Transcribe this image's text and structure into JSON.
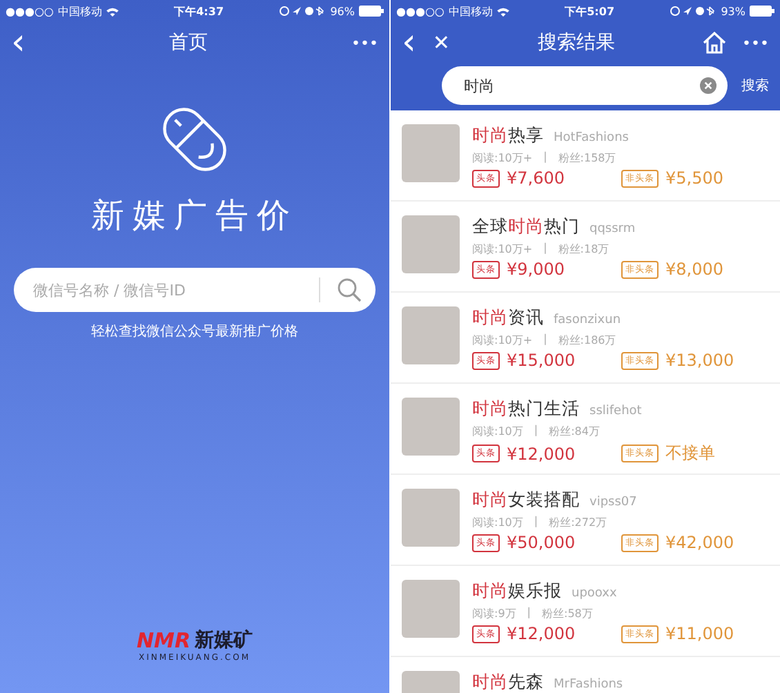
{
  "home_screen": {
    "status_bar": {
      "signal": "●●●○○",
      "carrier": "中国移动",
      "time": "下午4:37",
      "battery": "96%"
    },
    "nav": {
      "back": "‹",
      "title": "首页",
      "more": "•••"
    },
    "brand_title": "新媒广告价",
    "search": {
      "placeholder": "微信号名称 / 微信号ID"
    },
    "hint": "轻松查找微信公众号最新推广价格",
    "footer_logo": {
      "mark": "NMR",
      "name": "新媒矿",
      "domain": "XINMEIKUANG.COM"
    }
  },
  "results_screen": {
    "status_bar": {
      "signal": "●●●○○",
      "carrier": "中国移动",
      "time": "下午5:07",
      "battery": "93%"
    },
    "nav": {
      "back": "‹",
      "close": "✕",
      "title": "搜索结果",
      "more": "•••"
    },
    "search": {
      "value": "时尚",
      "button": "搜索"
    },
    "results": [
      {
        "title": [
          {
            "text": "时尚",
            "match": true
          },
          {
            "text": "热享",
            "match": false
          }
        ],
        "handle": "HotFashions",
        "reads": "阅读:10万+",
        "divider": "|",
        "fans": "粉丝:158万",
        "tag_a": "头条",
        "price_a": "¥7,600",
        "tag_b": "非头条",
        "price_b": "¥5,500"
      },
      {
        "title": [
          {
            "text": "全球",
            "match": false
          },
          {
            "text": "时尚",
            "match": true
          },
          {
            "text": "热门",
            "match": false
          }
        ],
        "handle": "qqssrm",
        "reads": "阅读:10万+",
        "divider": "|",
        "fans": "粉丝:18万",
        "tag_a": "头条",
        "price_a": "¥9,000",
        "tag_b": "非头条",
        "price_b": "¥8,000"
      },
      {
        "title": [
          {
            "text": "时尚",
            "match": true
          },
          {
            "text": "资讯",
            "match": false
          }
        ],
        "handle": "fasonzixun",
        "reads": "阅读:10万+",
        "divider": "|",
        "fans": "粉丝:186万",
        "tag_a": "头条",
        "price_a": "¥15,000",
        "tag_b": "非头条",
        "price_b": "¥13,000"
      },
      {
        "title": [
          {
            "text": "时尚",
            "match": true
          },
          {
            "text": "热门生活",
            "match": false
          }
        ],
        "handle": "sslifehot",
        "reads": "阅读:10万",
        "divider": "|",
        "fans": "粉丝:84万",
        "tag_a": "头条",
        "price_a": "¥12,000",
        "tag_b": "非头条",
        "price_b": "不接单"
      },
      {
        "title": [
          {
            "text": "时尚",
            "match": true
          },
          {
            "text": "女装搭配",
            "match": false
          }
        ],
        "handle": "vipss07",
        "reads": "阅读:10万",
        "divider": "|",
        "fans": "粉丝:272万",
        "tag_a": "头条",
        "price_a": "¥50,000",
        "tag_b": "非头条",
        "price_b": "¥42,000"
      },
      {
        "title": [
          {
            "text": "时尚",
            "match": true
          },
          {
            "text": "娱乐报",
            "match": false
          }
        ],
        "handle": "upooxx",
        "reads": "阅读:9万",
        "divider": "|",
        "fans": "粉丝:58万",
        "tag_a": "头条",
        "price_a": "¥12,000",
        "tag_b": "非头条",
        "price_b": "¥11,000"
      },
      {
        "title": [
          {
            "text": "时尚",
            "match": true
          },
          {
            "text": "先森",
            "match": false
          }
        ],
        "handle": "MrFashions"
      }
    ]
  }
}
